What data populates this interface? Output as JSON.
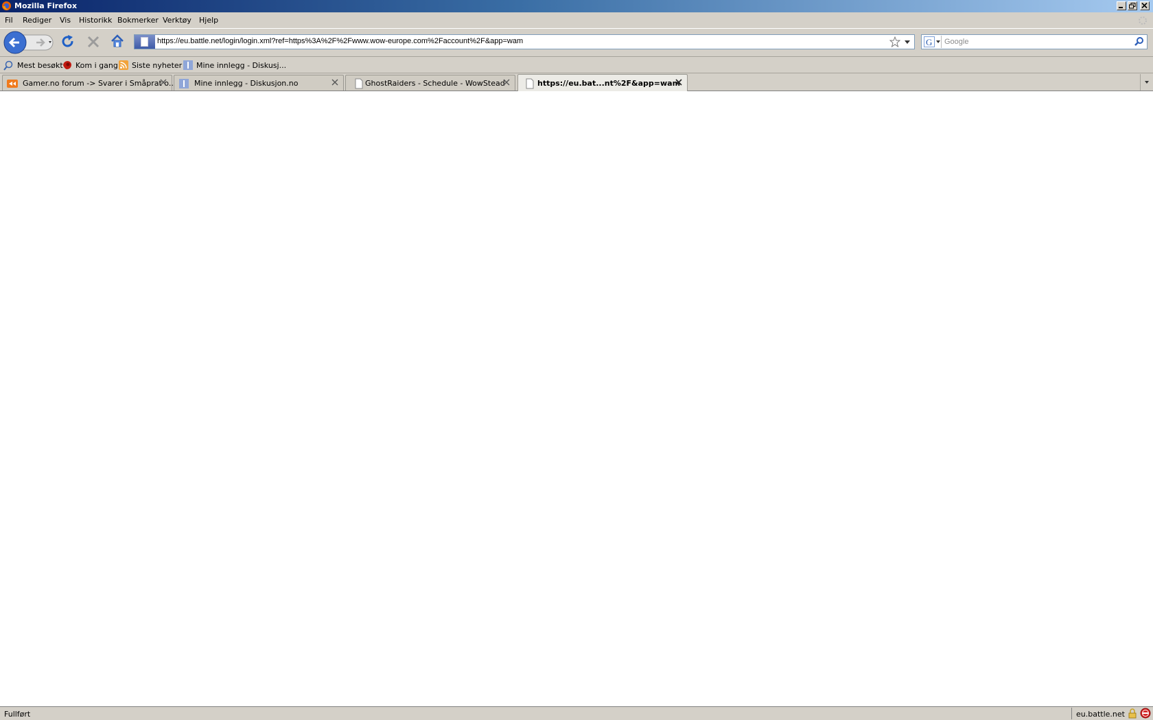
{
  "window": {
    "title": "Mozilla Firefox"
  },
  "menu": [
    "Fil",
    "Rediger",
    "Vis",
    "Historikk",
    "Bokmerker",
    "Verktøy",
    "Hjelp"
  ],
  "nav": {
    "url": "https://eu.battle.net/login/login.xml?ref=https%3A%2F%2Fwww.wow-europe.com%2Faccount%2F&app=wam",
    "search_placeholder": "Google"
  },
  "bookmarks": [
    {
      "label": "Mest besøkt",
      "icon": "most-visited-icon"
    },
    {
      "label": "Kom i gang",
      "icon": "firefox-icon"
    },
    {
      "label": "Siste nyheter",
      "icon": "rss-icon"
    },
    {
      "label": "Mine innlegg - Diskusj...",
      "icon": "diskusjon-icon"
    }
  ],
  "tabs": [
    {
      "label": "Gamer.no forum -> Svarer i Småprat o...",
      "icon": "gamer-icon"
    },
    {
      "label": "Mine innlegg - Diskusjon.no",
      "icon": "diskusjon-icon"
    },
    {
      "label": "GhostRaiders - Schedule - WowStead",
      "icon": "blank-page-icon"
    },
    {
      "label": "https://eu.bat...nt%2F&app=wam",
      "icon": "blank-page-icon",
      "active": true
    }
  ],
  "status": {
    "text": "Fullført",
    "domain": "eu.battle.net"
  }
}
